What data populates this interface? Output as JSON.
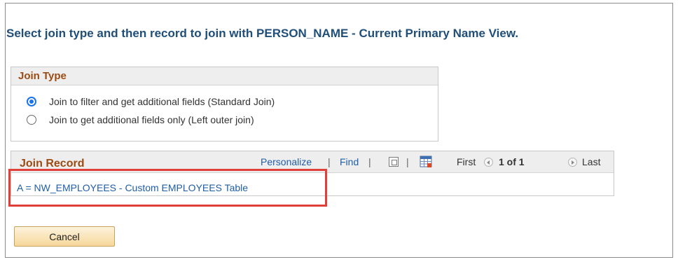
{
  "page": {
    "title": "Select join type and then record to join with PERSON_NAME - Current Primary Name View."
  },
  "join_type": {
    "heading": "Join Type",
    "options": [
      {
        "label": "Join to filter and get additional fields (Standard Join)",
        "selected": true
      },
      {
        "label": "Join to get additional fields only (Left outer join)",
        "selected": false
      }
    ]
  },
  "join_record": {
    "heading": "Join Record",
    "toolbar": {
      "personalize": "Personalize",
      "find": "Find",
      "separator": "|",
      "zoom_icon": "view-all-icon",
      "download_icon": "download-grid-icon"
    },
    "pagination": {
      "first": "First",
      "count": "1 of 1",
      "last": "Last"
    },
    "records": [
      {
        "label": "A = NW_EMPLOYEES - Custom EMPLOYEES Table"
      }
    ]
  },
  "actions": {
    "cancel": "Cancel"
  },
  "colors": {
    "title": "#1f4e79",
    "heading": "#9c4b12",
    "link": "#1f5ea8",
    "highlight": "#e0403a"
  }
}
